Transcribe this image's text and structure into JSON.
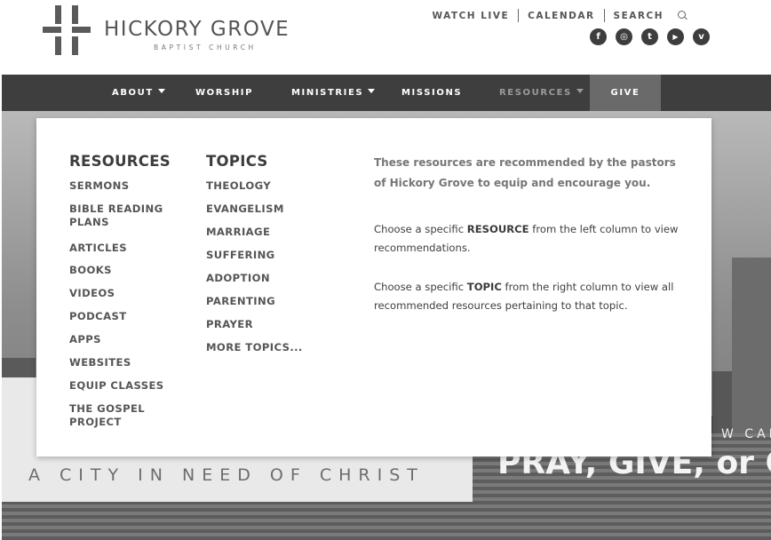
{
  "brand": {
    "name": "HICKORY GROVE",
    "subtitle": "BAPTIST CHURCH"
  },
  "utility": {
    "watch_live": "WATCH LIVE",
    "calendar": "CALENDAR",
    "search": "SEARCH"
  },
  "social": {
    "facebook": "f",
    "instagram": "◎",
    "twitter": "t",
    "youtube": "▶",
    "vimeo": "v"
  },
  "nav": {
    "about": "ABOUT",
    "worship": "WORSHIP",
    "ministries": "MINISTRIES",
    "missions": "MISSIONS",
    "resources": "RESOURCES",
    "give": "GIVE"
  },
  "mega": {
    "resources_title": "RESOURCES",
    "topics_title": "TOPICS",
    "resources": [
      "SERMONS",
      "BIBLE READING PLANS",
      "ARTICLES",
      "BOOKS",
      "VIDEOS",
      "PODCAST",
      "APPS",
      "WEBSITES",
      "EQUIP CLASSES",
      "THE GOSPEL PROJECT"
    ],
    "topics": [
      "THEOLOGY",
      "EVANGELISM",
      "MARRIAGE",
      "SUFFERING",
      "ADOPTION",
      "PARENTING",
      "PRAYER",
      "MORE TOPICS..."
    ],
    "intro": "These resources are recommended by the pastors of Hickory Grove to equip and encourage you.",
    "resource_hint_pre": "Choose a specific ",
    "resource_hint_bold": "RESOURCE",
    "resource_hint_post": " from the left column to view recommendations.",
    "topic_hint_pre": "Choose a specific ",
    "topic_hint_bold": "TOPIC",
    "topic_hint_post": " from the right column to view all recommended resources pertaining to that topic."
  },
  "hero": {
    "subtitle": "A CITY IN NEED OF CHRIST",
    "headline": "PRAY, GIVE, or GO",
    "small_line": "W CAN"
  }
}
